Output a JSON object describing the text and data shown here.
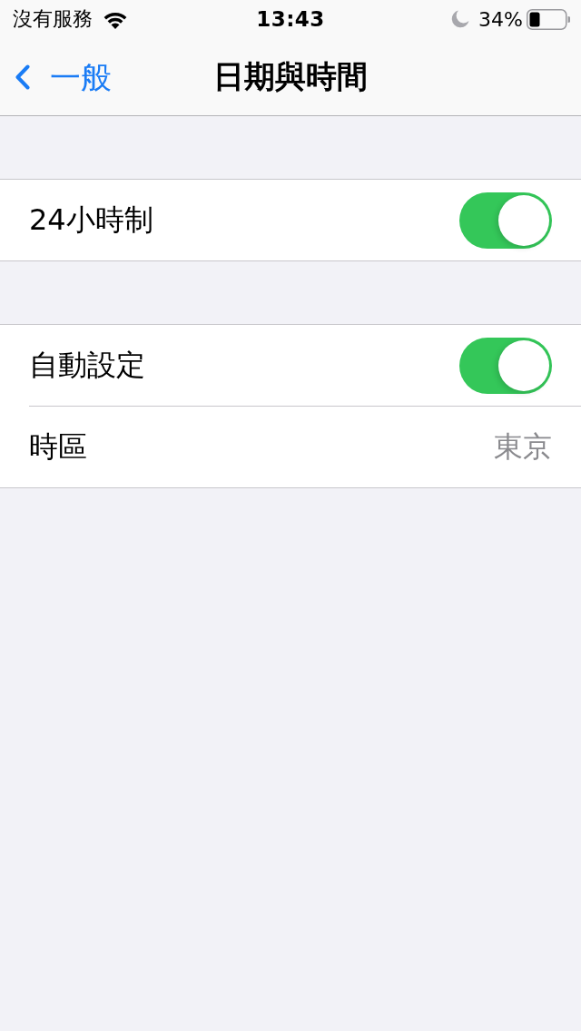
{
  "status_bar": {
    "carrier": "沒有服務",
    "time": "13:43",
    "battery": "34%"
  },
  "nav": {
    "back": "一般",
    "title": "日期與時間"
  },
  "sections": [
    {
      "rows": [
        {
          "kind": "toggle",
          "label": "24小時制",
          "on": true
        }
      ]
    },
    {
      "rows": [
        {
          "kind": "toggle",
          "label": "自動設定",
          "on": true
        },
        {
          "kind": "value",
          "label": "時區",
          "value": "東京"
        }
      ]
    }
  ]
}
